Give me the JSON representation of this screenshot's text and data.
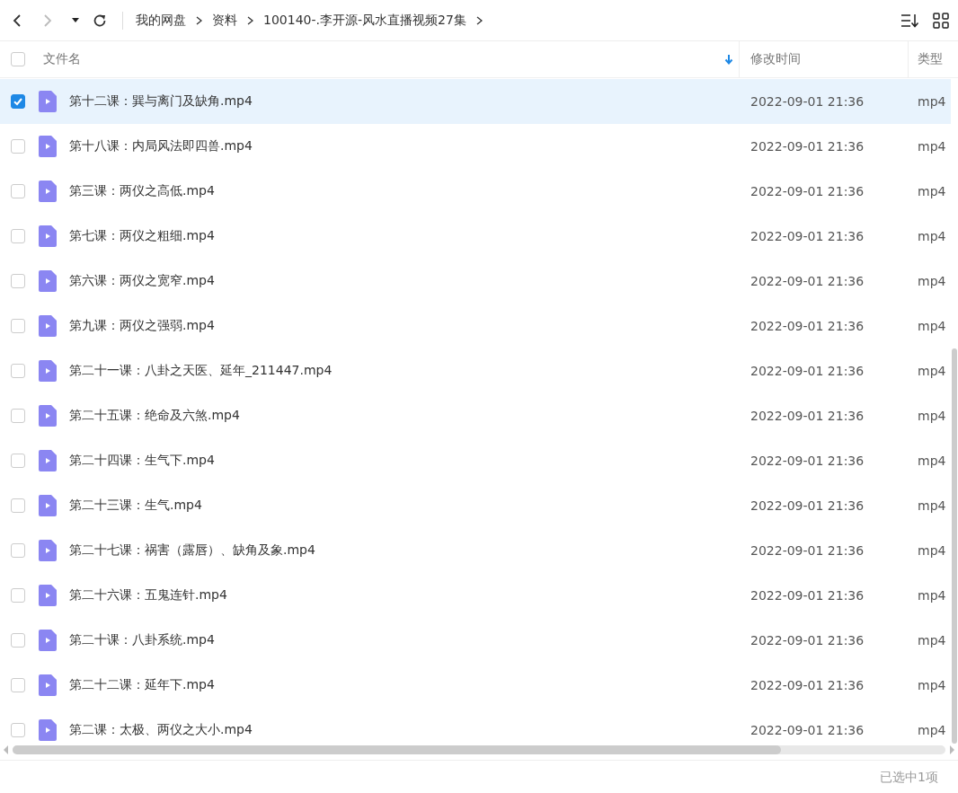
{
  "toolbar": {
    "breadcrumbs": [
      "我的网盘",
      "资料",
      "100140-.李开源-风水直播视频27集"
    ]
  },
  "table": {
    "select_all": {
      "checked": false
    },
    "columns": [
      {
        "label": "文件名",
        "sorted": true
      },
      {
        "label": "修改时间",
        "sorted": false
      },
      {
        "label": "类型",
        "sorted": false
      }
    ],
    "rows": [
      {
        "name": "第十二课：巽与离门及缺角.mp4",
        "modified": "2022-09-01 21:36",
        "type": "mp4",
        "selected": true
      },
      {
        "name": "第十八课：内局风法即四兽.mp4",
        "modified": "2022-09-01 21:36",
        "type": "mp4",
        "selected": false
      },
      {
        "name": "第三课：两仪之高低.mp4",
        "modified": "2022-09-01 21:36",
        "type": "mp4",
        "selected": false
      },
      {
        "name": "第七课：两仪之粗细.mp4",
        "modified": "2022-09-01 21:36",
        "type": "mp4",
        "selected": false
      },
      {
        "name": "第六课：两仪之宽窄.mp4",
        "modified": "2022-09-01 21:36",
        "type": "mp4",
        "selected": false
      },
      {
        "name": "第九课：两仪之强弱.mp4",
        "modified": "2022-09-01 21:36",
        "type": "mp4",
        "selected": false
      },
      {
        "name": "第二十一课：八卦之天医、延年_211447.mp4",
        "modified": "2022-09-01 21:36",
        "type": "mp4",
        "selected": false
      },
      {
        "name": "第二十五课：绝命及六煞.mp4",
        "modified": "2022-09-01 21:36",
        "type": "mp4",
        "selected": false
      },
      {
        "name": "第二十四课：生气下.mp4",
        "modified": "2022-09-01 21:36",
        "type": "mp4",
        "selected": false
      },
      {
        "name": "第二十三课：生气.mp4",
        "modified": "2022-09-01 21:36",
        "type": "mp4",
        "selected": false
      },
      {
        "name": "第二十七课：祸害（露唇）、缺角及象.mp4",
        "modified": "2022-09-01 21:36",
        "type": "mp4",
        "selected": false
      },
      {
        "name": "第二十六课：五鬼连针.mp4",
        "modified": "2022-09-01 21:36",
        "type": "mp4",
        "selected": false
      },
      {
        "name": "第二十课：八卦系统.mp4",
        "modified": "2022-09-01 21:36",
        "type": "mp4",
        "selected": false
      },
      {
        "name": "第二十二课：延年下.mp4",
        "modified": "2022-09-01 21:36",
        "type": "mp4",
        "selected": false
      },
      {
        "name": "第二课：太极、两仪之大小.mp4",
        "modified": "2022-09-01 21:36",
        "type": "mp4",
        "selected": false
      }
    ]
  },
  "status_bar": {
    "selection": "已选中1项"
  }
}
